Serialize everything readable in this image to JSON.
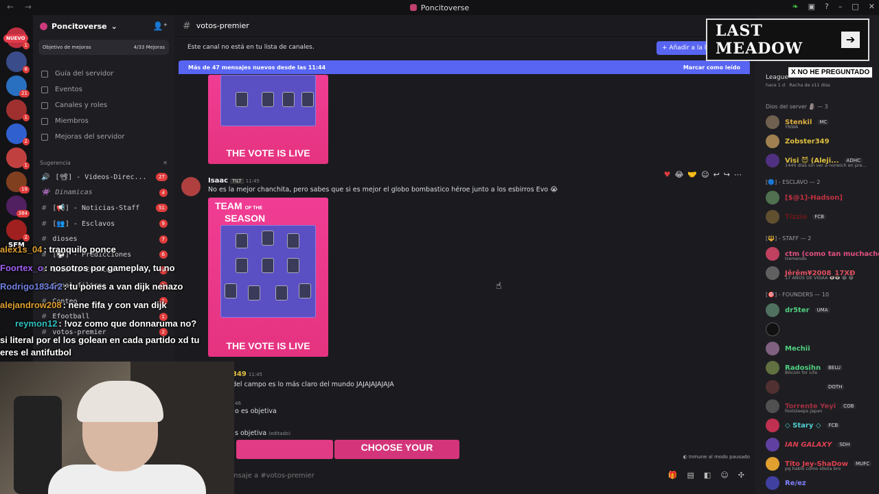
{
  "window": {
    "title": "Poncitoverse"
  },
  "servers": {
    "nuevo": "NUEVO",
    "badges": [
      "1",
      "8",
      "21",
      "1",
      "2",
      "1",
      "19",
      "384",
      "2"
    ],
    "sfm": "SFM"
  },
  "server": {
    "name": "Poncitoverse",
    "boost_label": "Objetivo de mejoras",
    "boost_count": "4/33 Mejoras"
  },
  "nav": [
    "Guía del servidor",
    "Eventos",
    "Canales y roles",
    "Miembros",
    "Mejoras del servidor"
  ],
  "category": "Sugerencia",
  "channels": [
    {
      "name": "[📽] - Videos-Direc...",
      "badge": "27"
    },
    {
      "name": "Dinamicas",
      "badge": "4"
    },
    {
      "name": "[📢] - Noticias-Staff",
      "badge": "51"
    },
    {
      "name": "[👥] - Esclavos",
      "badge": "9"
    },
    {
      "name": "dioses",
      "badge": "7"
    },
    {
      "name": "[⚽] - Predicciones",
      "badge": "6"
    },
    {
      "name": "Guia-de-Eventos",
      "badge": "4"
    },
    {
      "name": "Canal-filtros",
      "badge": "3"
    },
    {
      "name": "Conteo",
      "badge": "1"
    },
    {
      "name": "Efootball",
      "badge": "1"
    },
    {
      "name": "votos-premier",
      "badge": "2"
    }
  ],
  "chat": {
    "channel": "votos-premier",
    "notice": "Este canal no está en tu lista de canales.",
    "add_button": "Añadir a la li",
    "newbar_text": "Más de 47 mensajes nuevos desde las 11:44",
    "newbar_action": "Marcar como leído",
    "img_header1": "TEAM",
    "img_header2": "SEASON",
    "img_ofthe": "OF THE",
    "vote_live": "THE VOTE IS LIVE",
    "msg1_user": "Isaac",
    "msg1_tag": "TILT",
    "msg1_time": "11:45",
    "msg1_text": "No es la mejor chanchita, pero sabes que si es mejor el globo bombastico héroe junto a los esbirros Evo 😭",
    "msg2_user": "349",
    "msg2_time": "11:45",
    "msg2_text": "del campo es lo más claro del mundo JAJAJAJAJAJA",
    "msg3_text": "o es objetiva",
    "msg3_time": "46",
    "msg4_text": "s objetiva",
    "msg4_edit": "(editado)",
    "choose": "CHOOSE YOUR",
    "paused": "Inmune al modo pausado",
    "input_placeholder": "ensaje a #votos-premier"
  },
  "members": {
    "top_name": "League",
    "top_sub1": "hace 1 d",
    "top_sub2": "Racha de x11 días",
    "groups": [
      {
        "title": "Dios del server 🗿 — 3",
        "items": [
          {
            "name": "Stenkil",
            "color": "#e0b040",
            "tag": "MC",
            "sub": "YNWA"
          },
          {
            "name": "Zobster349",
            "color": "#e0c040",
            "tag": "",
            "sub": ""
          },
          {
            "name": "Visi 😈 (Aleji...",
            "color": "#e0c040",
            "tag": "ADHC",
            "sub": "1440 días sin ver a norwich en pre..."
          }
        ]
      },
      {
        "title": "[🔵] - ESCLAVO — 2",
        "items": [
          {
            "name": "[$@1]-Hadson]",
            "color": "#c03040",
            "tag": "",
            "sub": ""
          },
          {
            "name": "Tizzio",
            "color": "#8a2020",
            "tag": "FCB",
            "sub": ""
          }
        ]
      },
      {
        "title": "[🔱] - STAFF — 2",
        "items": [
          {
            "name": "ctm (como tan muchacho)",
            "color": "#e05080",
            "tag": "",
            "sub": "tremendo"
          },
          {
            "name": "Jêrêm¥2008_17XÐ",
            "color": "#e05060",
            "tag": "",
            "sub": "17 AÑOS DE VIDAA 👁️👁️ 😂 😂"
          }
        ]
      },
      {
        "title": "[🎯] - FOUNDERS — 10",
        "items": [
          {
            "name": "dr5ter",
            "color": "#50d080",
            "tag": "UMA",
            "sub": ""
          },
          {
            "name": "",
            "color": "#ccc",
            "tag": "",
            "sub": ""
          },
          {
            "name": "Mechii",
            "color": "#50d080",
            "tag": "",
            "sub": ""
          },
          {
            "name": "Radosihn",
            "color": "#50d080",
            "tag": "BELU",
            "sub": "Bitcoin for Life"
          },
          {
            "name": "",
            "color": "#ccc",
            "tag": "DOTH",
            "sub": ""
          },
          {
            "name": "Torrente Yeyi",
            "color": "#b03040",
            "tag": "COB",
            "sub": "footsteeps japan"
          },
          {
            "name": "◇ Stary ◇",
            "color": "#50d0d0",
            "tag": "FCB",
            "sub": ""
          },
          {
            "name": "IAN GALAXY",
            "color": "#e04050",
            "tag": "SDH",
            "sub": ""
          },
          {
            "name": "Tito Jey-ShaDow",
            "color": "#e04050",
            "tag": "MUFC",
            "sub": "pq hablo cómo idiota bro"
          },
          {
            "name": "Re/ez",
            "color": "#8080ff",
            "tag": "",
            "sub": ""
          }
        ]
      }
    ]
  },
  "stream": {
    "sponsor": "LAST MEADOW",
    "xno": "X NO HE PREGUNTADO",
    "chat": [
      {
        "user": "alex1s_04",
        "color": "#e0a030",
        "text": ": tranquilo ponce"
      },
      {
        "user": "Foortex_o",
        "color": "#a060f0",
        "text": ": nosotros por gameplay, tu no"
      },
      {
        "user": "Rodrigo1834r2",
        "color": "#7080e0",
        "text": ": tu pones a van dijk nenazo"
      },
      {
        "user": "alejandrow208",
        "color": "#e0a030",
        "text": ": nene fifa y con van dijk"
      },
      {
        "user": "reymon12",
        "color": "#30c0c0",
        "text": ": !voz como que donnaruma no?"
      },
      {
        "user": "",
        "color": "#fff",
        "text": "si literal por el los golean en cada partido xd tu"
      },
      {
        "user": "",
        "color": "#fff",
        "text": "eres el antifutbol"
      }
    ]
  }
}
